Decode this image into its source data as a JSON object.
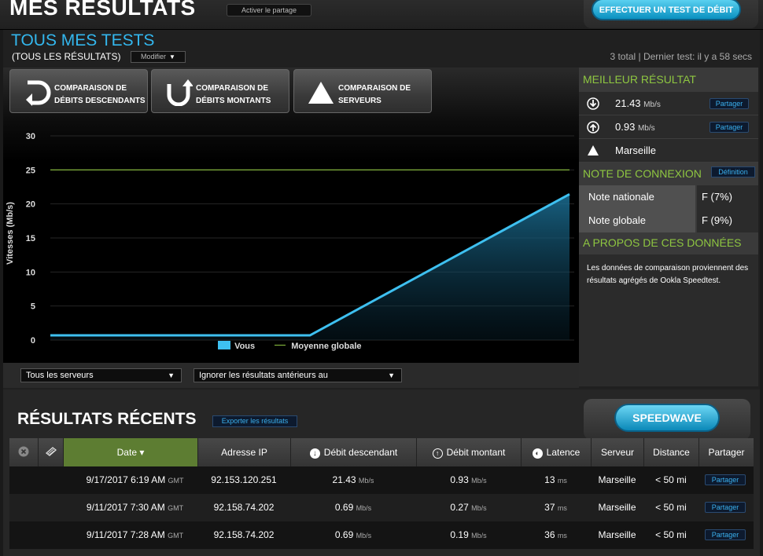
{
  "header": {
    "title": "MES RÉSULTATS",
    "share_toggle": "Activer le partage",
    "test_button": "EFFECTUER UN TEST DE DÉBIT"
  },
  "tests": {
    "title": "TOUS MES TESTS",
    "subtitle": "(TOUS LES RÉSULTATS)",
    "modify": "Modifier",
    "meta": "3 total | Dernier test: il y a 58 secs"
  },
  "tabs": [
    {
      "line1": "COMPARAISON DE",
      "line2": "DÉBITS DESCENDANTS"
    },
    {
      "line1": "COMPARAISON DE",
      "line2": "DÉBITS MONTANTS"
    },
    {
      "line1": "COMPARAISON DE",
      "line2": "SERVEURS"
    }
  ],
  "filters": {
    "servers": "Tous les serveurs",
    "ignore": "Ignorer les résultats antérieurs au"
  },
  "chart_data": {
    "type": "line",
    "ylabel": "Vitesses (Mb/s)",
    "xlabel": "",
    "ylim": [
      0,
      30
    ],
    "yticks": [
      "30",
      "25",
      "20",
      "15",
      "10",
      "5",
      "0"
    ],
    "grid": true,
    "legend_position": "bottom",
    "series": [
      {
        "name": "Vous",
        "values": [
          0.69,
          0.69,
          21.43
        ],
        "color": "#3ec0f0"
      },
      {
        "name": "Moyenne globale",
        "values": [
          25,
          25,
          25
        ],
        "color": "#8ec641"
      }
    ]
  },
  "sidebar": {
    "best_title": "MEILLEUR RÉSULTAT",
    "best": [
      {
        "icon": "download-icon",
        "value": "21.43",
        "unit": "Mb/s",
        "share": "Partager"
      },
      {
        "icon": "upload-icon",
        "value": "0.93",
        "unit": "Mb/s",
        "share": "Partager"
      },
      {
        "icon": "server-icon",
        "value": "Marseille"
      }
    ],
    "note_title": "NOTE DE CONNEXION",
    "definition": "Définition",
    "notes": [
      {
        "label": "Note nationale",
        "value": "F (7%)"
      },
      {
        "label": "Note globale",
        "value": "F (9%)"
      }
    ],
    "about_title": "A PROPOS DE CES DONNÉES",
    "about_text": "Les données de comparaison proviennent des résultats agrégés de Ookla Speedtest."
  },
  "recent": {
    "title": "RÉSULTATS RÉCENTS",
    "export": "Exporter les résultats",
    "speedwave": "SPEEDWAVE",
    "columns": [
      "Date ▾",
      "Adresse IP",
      "Débit descendant",
      "Débit montant",
      "Latence",
      "Serveur",
      "Distance",
      "Partager"
    ],
    "rows": [
      {
        "date": "9/17/2017 6:19 AM",
        "tz": "GMT",
        "ip": "92.153.120.251",
        "down": "21.43",
        "up": "0.93",
        "latency": "13",
        "server": "Marseille",
        "distance": "< 50 mi",
        "share": "Partager"
      },
      {
        "date": "9/11/2017 7:30 AM",
        "tz": "GMT",
        "ip": "92.158.74.202",
        "down": "0.69",
        "up": "0.27",
        "latency": "37",
        "server": "Marseille",
        "distance": "< 50 mi",
        "share": "Partager"
      },
      {
        "date": "9/11/2017 7:28 AM",
        "tz": "GMT",
        "ip": "92.158.74.202",
        "down": "0.69",
        "up": "0.19",
        "latency": "36",
        "server": "Marseille",
        "distance": "< 50 mi",
        "share": "Partager"
      }
    ],
    "units": {
      "speed": "Mb/s",
      "latency": "ms"
    }
  }
}
